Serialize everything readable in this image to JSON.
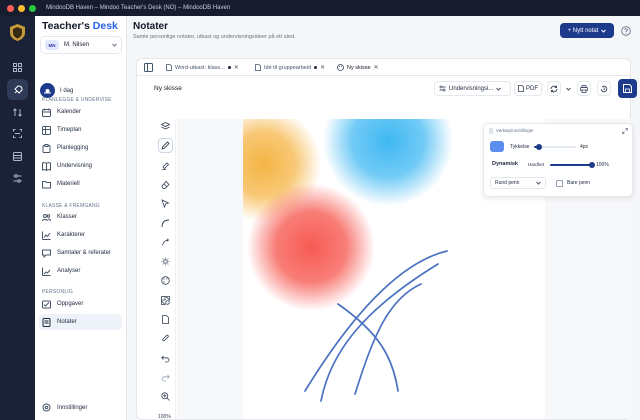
{
  "window": {
    "title": "MindooDB Haven – Mindoo Teacher's Desk (NO) – MindooDB Haven"
  },
  "brand": {
    "name": "Teacher's",
    "accent": "Desk",
    "color": "#2563eb"
  },
  "user": {
    "initials": "MN",
    "name": "M. Nilsen"
  },
  "today_label": "I dag",
  "sections": {
    "planning": "PLANLEGGE & UNDERVISE",
    "classes": "KLASSE & FREMGANG",
    "personal": "PERSONLIG"
  },
  "nav": {
    "planning": [
      {
        "label": "Kalender",
        "icon": "calendar-icon"
      },
      {
        "label": "Timeplan",
        "icon": "schedule-icon"
      },
      {
        "label": "Planlegging",
        "icon": "clipboard-icon"
      },
      {
        "label": "Undervisning",
        "icon": "book-icon"
      },
      {
        "label": "Materiell",
        "icon": "folder-icon"
      }
    ],
    "classes": [
      {
        "label": "Klasser",
        "icon": "users-icon"
      },
      {
        "label": "Karakterer",
        "icon": "grades-icon"
      },
      {
        "label": "Samtaler & referater",
        "icon": "chat-icon"
      },
      {
        "label": "Analyser",
        "icon": "chart-icon"
      }
    ],
    "personal": [
      {
        "label": "Oppgaver",
        "icon": "tasks-icon"
      },
      {
        "label": "Notater",
        "icon": "notes-icon",
        "active": true
      }
    ]
  },
  "settings_label": "Innstillinger",
  "page": {
    "title": "Notater",
    "subtitle": "Samle personlige notater, utkast og undervisningsideer på ett sted.",
    "new_button": "+ Nytt notat"
  },
  "tabs": [
    {
      "label": "Word-utkast: klass...",
      "icon": "document-icon",
      "dirty": true
    },
    {
      "label": "Idé til gruppearbeid",
      "icon": "document-icon",
      "dirty": true
    },
    {
      "label": "Ny skisse",
      "icon": "palette-icon",
      "active": true
    }
  ],
  "editor": {
    "note_name": "Ny skisse",
    "template_select": "Undervisningsi...",
    "pdf_label": "PDF",
    "zoom": "100%"
  },
  "tools": [
    "layers-icon",
    "pencil-icon",
    "highlighter-icon",
    "eraser-icon",
    "select-icon",
    "curve-icon",
    "arrow-icon",
    "brightness-icon",
    "palette-icon",
    "shapes-icon",
    "page-icon",
    "attach-icon",
    "undo-icon",
    "redo-icon",
    "zoom-in-icon"
  ],
  "active_tool": "pencil-icon",
  "tool_settings": {
    "title": "Verktøyinnstillinger",
    "color": "#5b8def",
    "thickness_label": "Tykkelse",
    "thickness_value": "4px",
    "thickness_fraction": 0.12,
    "dynamic_label": "Dynamisk",
    "hardness_label": "Hardhet",
    "hardness_value": "100%",
    "hardness_fraction": 1.0,
    "pen_type": "Rund penn",
    "only_pen_label": "Bare penn"
  },
  "colors": {
    "orange_blob": "#f5b03b",
    "blue_blob": "#35b4f2",
    "red_blob": "#f6524a",
    "stroke": "#4a72c0"
  }
}
